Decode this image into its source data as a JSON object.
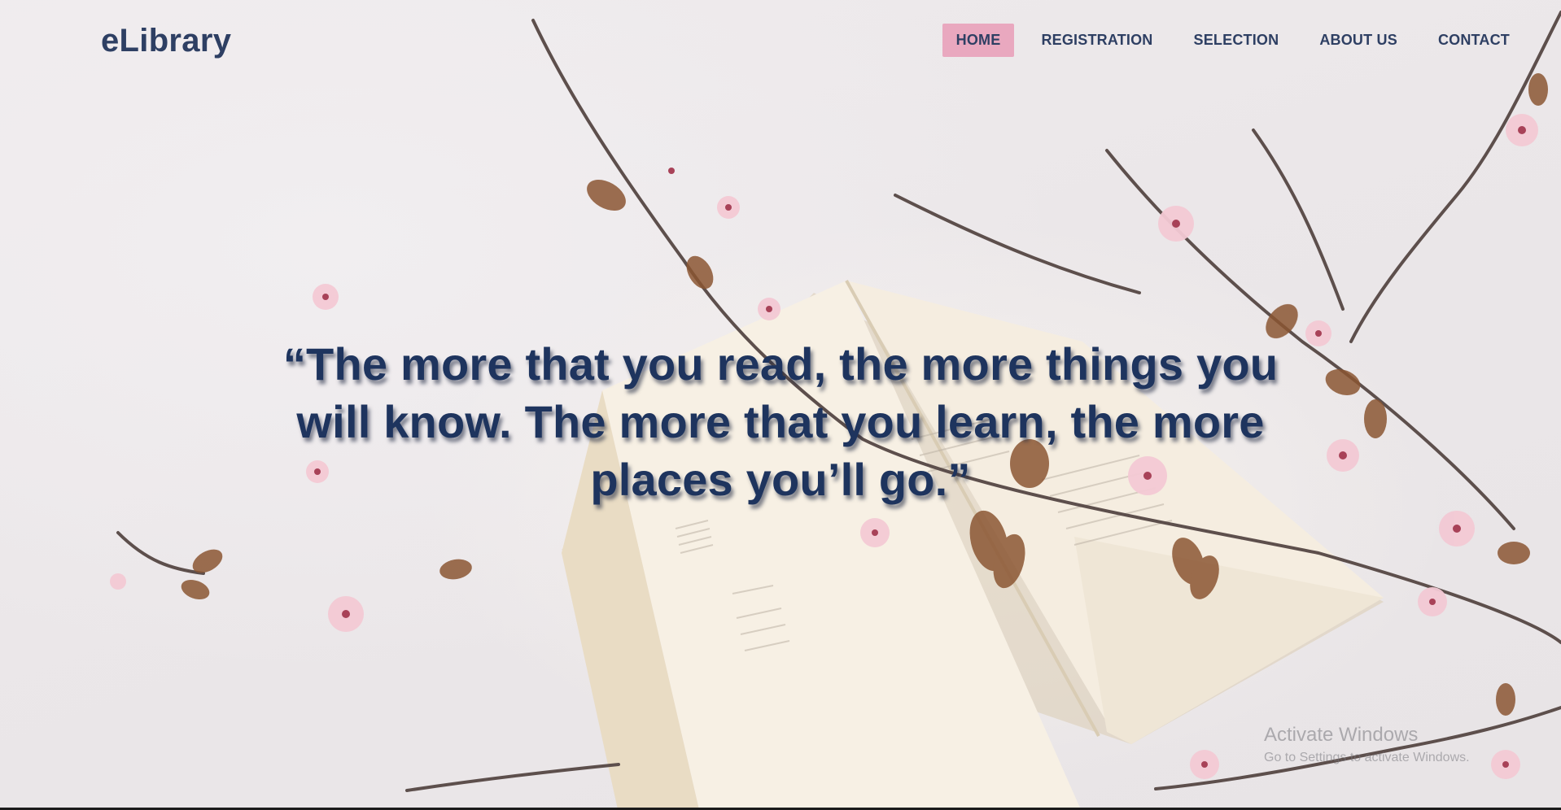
{
  "header": {
    "logo_text": "eLibrary",
    "nav": [
      {
        "label": "HOME",
        "active": true
      },
      {
        "label": "REGISTRATION",
        "active": false
      },
      {
        "label": "SELECTION",
        "active": false
      },
      {
        "label": "ABOUT US",
        "active": false
      },
      {
        "label": "CONTACT",
        "active": false
      }
    ]
  },
  "hero": {
    "quote": "“The more that you read, the more things you will know. The more that you learn, the more places you’ll go.”",
    "background_icon": "book-and-cherry-blossoms"
  },
  "os_overlay": {
    "title": "Activate Windows",
    "subtitle": "Go to Settings to activate Windows."
  },
  "colors": {
    "brand_text": "#2e3f63",
    "quote_text": "#1e345e",
    "active_nav_bg": "#e9a8bf",
    "background": "#ece8ea"
  }
}
